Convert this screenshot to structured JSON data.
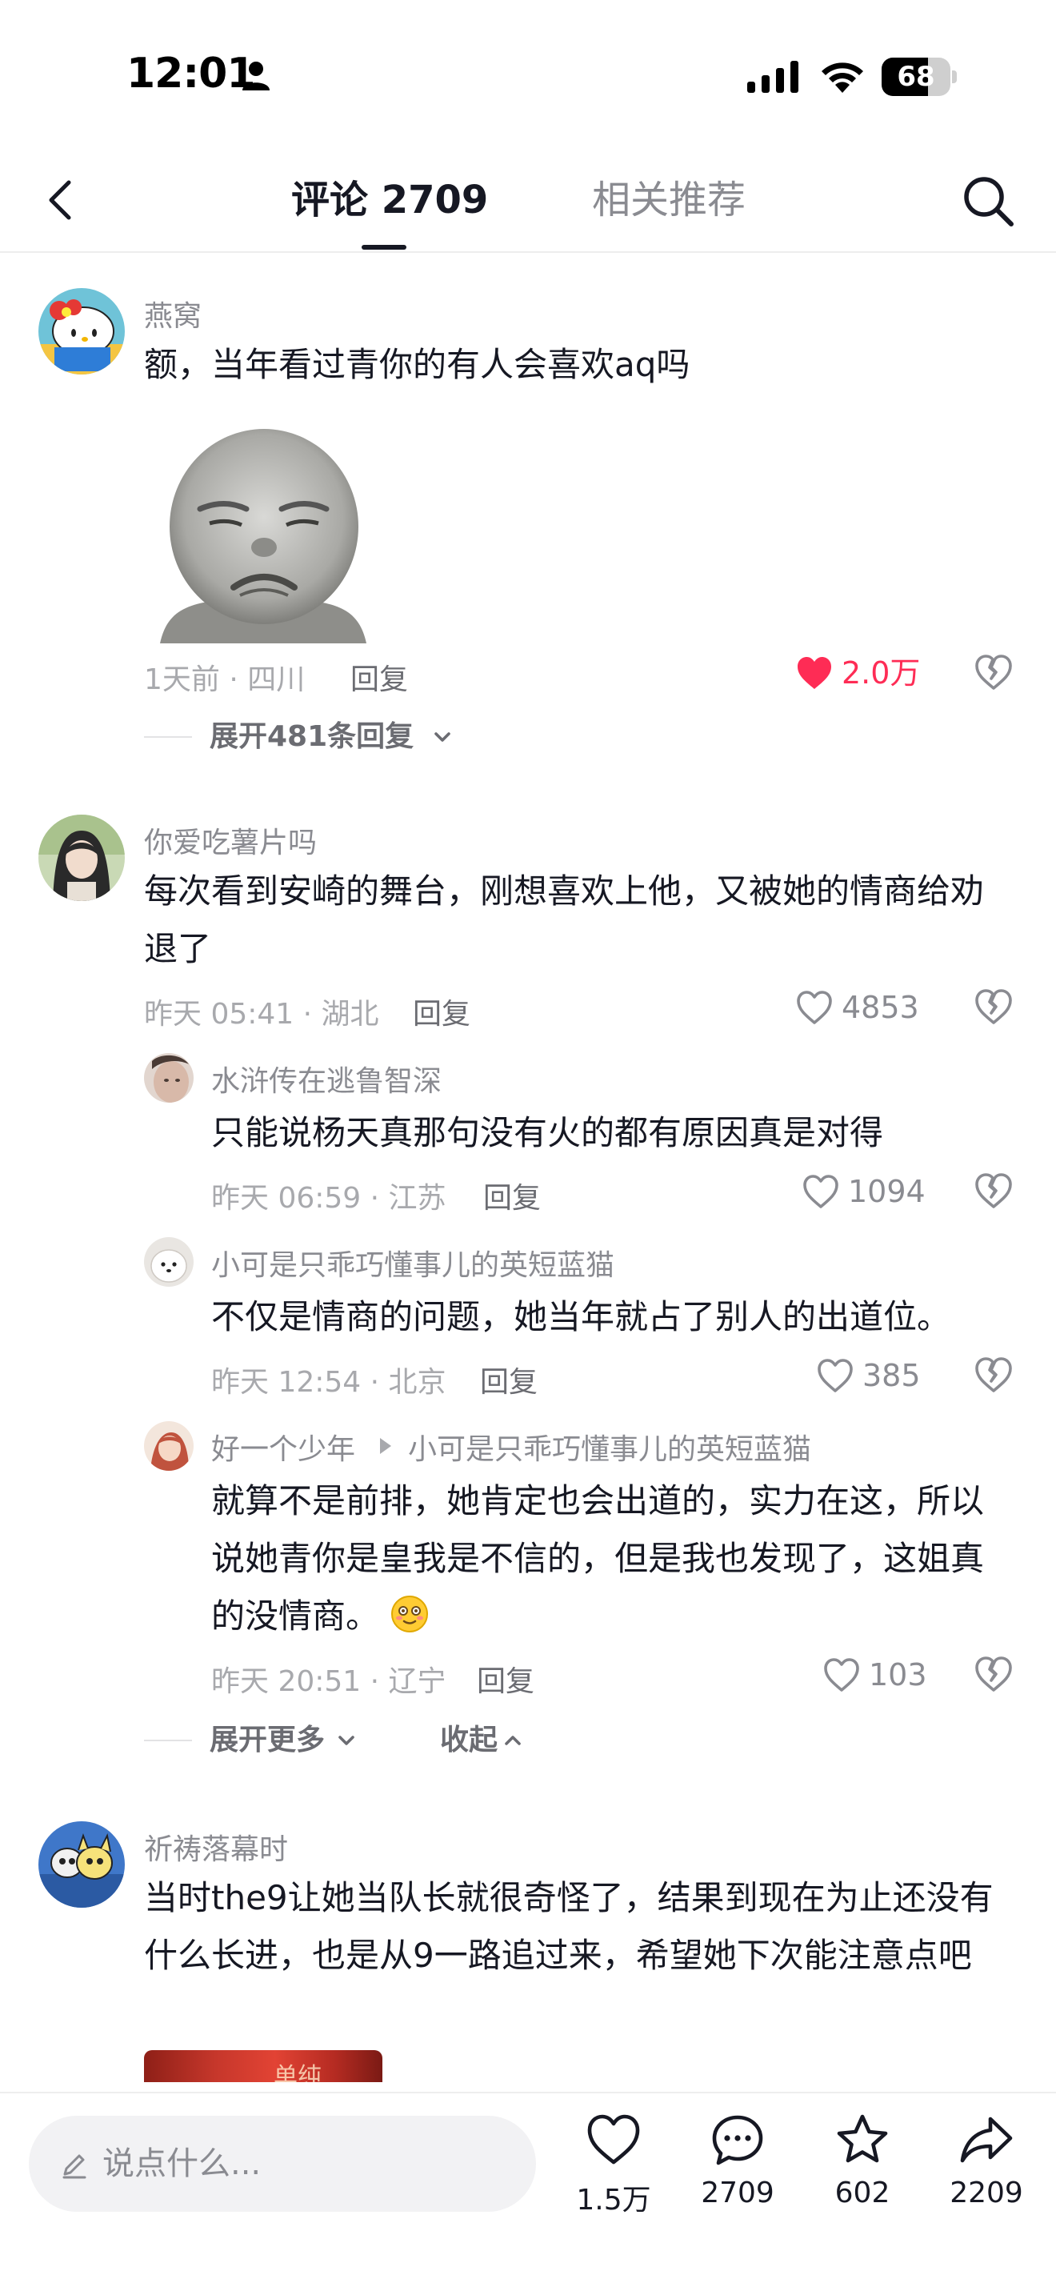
{
  "status_bar": {
    "time": "12:01",
    "battery": "68",
    "battery_percent": 68
  },
  "header": {
    "tabs": [
      {
        "label": "评论 2709",
        "active": true
      },
      {
        "label": "相关推荐",
        "active": false
      }
    ]
  },
  "comments": [
    {
      "username": "燕窝",
      "text": "额，当年看过青你的有人会喜欢aq吗",
      "meta": "1天前 · 四川",
      "reply": "回复",
      "likes": "2.0万",
      "liked": true,
      "expand": "展开481条回复"
    },
    {
      "username": "你爱吃薯片吗",
      "text": "每次看到安崎的舞台，刚想喜欢上他，又被她的情商给劝退了",
      "meta": "昨天 05:41 · 湖北",
      "reply": "回复",
      "likes": "4853",
      "replies": [
        {
          "username": "水浒传在逃鲁智深",
          "text": "只能说杨天真那句没有火的都有原因真是对得",
          "meta": "昨天 06:59 · 江苏",
          "reply": "回复",
          "likes": "1094"
        },
        {
          "username": "小可是只乖巧懂事儿的英短蓝猫",
          "text": "不仅是情商的问题，她当年就占了别人的出道位。",
          "meta": "昨天 12:54 · 北京",
          "reply": "回复",
          "likes": "385"
        },
        {
          "username": "好一个少年",
          "reply_to": "小可是只乖巧懂事儿的英短蓝猫",
          "text": "就算不是前排，她肯定也会出道的，实力在这，所以说她青你是皇我是不信的，但是我也发现了，这姐真的没情商。",
          "meta": "昨天 20:51 · 辽宁",
          "reply": "回复",
          "likes": "103"
        }
      ],
      "expand_more": "展开更多",
      "collapse": "收起"
    },
    {
      "username": "祈祷落幕时",
      "text": "当时the9让她当队长就很奇怪了，结果到现在为止还没有什么长进，也是从9一路追过来，希望她下次能注意点吧",
      "thumb_text": "单纯"
    }
  ],
  "bottom_bar": {
    "input_placeholder": "说点什么...",
    "likes": "1.5万",
    "comments": "2709",
    "favorites": "602",
    "shares": "2209"
  },
  "colors": {
    "accent_red": "#fe2c55",
    "text_primary": "#161823",
    "text_secondary": "#8a8b91"
  }
}
